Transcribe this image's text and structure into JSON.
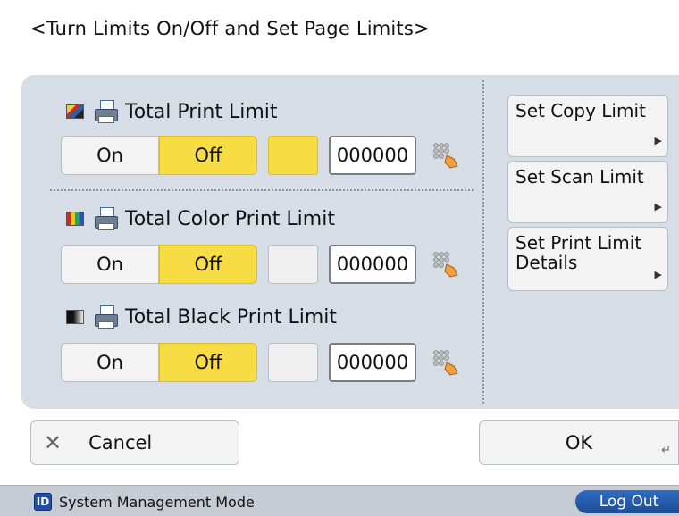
{
  "title": "<Turn Limits On/Off and Set Page Limits>",
  "limits": [
    {
      "label": "Total Print Limit",
      "on": "On",
      "off": "Off",
      "value": "000000",
      "icon": "color-mixed-icon"
    },
    {
      "label": "Total Color Print Limit",
      "on": "On",
      "off": "Off",
      "value": "000000",
      "icon": "color-rainbow-icon"
    },
    {
      "label": "Total Black Print Limit",
      "on": "On",
      "off": "Off",
      "value": "000000",
      "icon": "black-gradient-icon"
    }
  ],
  "side": {
    "copy": "Set Copy Limit",
    "scan": "Set Scan Limit",
    "print": "Set Print Limit Details"
  },
  "footer": {
    "cancel": "Cancel",
    "ok": "OK"
  },
  "status": {
    "id_badge": "ID",
    "mode": "System Management Mode",
    "logout": "Log Out"
  },
  "colors": {
    "selected": "#f7dd43",
    "panel": "#d7dde6",
    "logout": "#2f6cc2"
  }
}
